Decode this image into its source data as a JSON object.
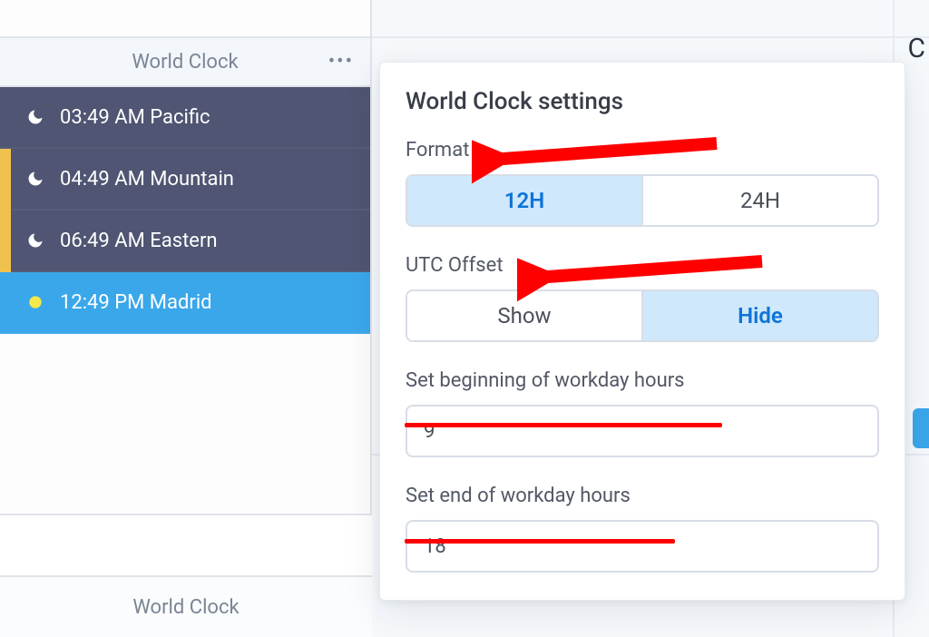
{
  "sidebar": {
    "title": "World Clock",
    "footer_label": "World Clock",
    "clocks": [
      {
        "time": "03:49 AM Pacific",
        "phase": "night",
        "bg": "dark"
      },
      {
        "time": "04:49 AM Mountain",
        "phase": "night",
        "bg": "dark"
      },
      {
        "time": "06:49 AM Eastern",
        "phase": "night",
        "bg": "dark"
      },
      {
        "time": "12:49 PM Madrid",
        "phase": "day",
        "bg": "day"
      }
    ],
    "accent_color": "#f1c14e"
  },
  "settings": {
    "title": "World Clock settings",
    "format": {
      "label": "Format",
      "options": [
        "12H",
        "24H"
      ],
      "selected": "12H"
    },
    "utc_offset": {
      "label": "UTC Offset",
      "options": [
        "Show",
        "Hide"
      ],
      "selected": "Hide"
    },
    "workday_begin": {
      "label": "Set beginning of workday hours",
      "value": "9"
    },
    "workday_end": {
      "label": "Set end of workday hours",
      "value": "18"
    }
  },
  "annotations": {
    "arrow_color": "#ff0000",
    "arrow_targets": [
      "format.label",
      "utc_offset.label"
    ],
    "underline_targets": [
      "workday_begin.label",
      "workday_end.label"
    ]
  },
  "icons": {
    "moon": "moon-icon",
    "sun": "sun-icon",
    "more": "more-icon"
  },
  "bg": {
    "corner_letter": "C"
  }
}
